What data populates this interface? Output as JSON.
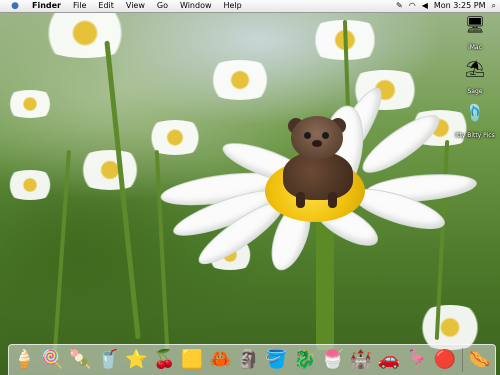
{
  "menubar": {
    "apple_label": "",
    "app_name": "Finder",
    "menus": [
      "File",
      "Edit",
      "View",
      "Go",
      "Window",
      "Help"
    ],
    "clock": "Mon 3:25 PM"
  },
  "desktop_icons": [
    {
      "label": "iMac",
      "icon": "hard-drive-icon"
    },
    {
      "label": "Sage",
      "icon": "beach-umbrella-icon"
    },
    {
      "label": "Itty Bitty Pics",
      "icon": "flip-flops-icon"
    }
  ],
  "dock": {
    "items": [
      {
        "icon": "ice-cream-cone-icon",
        "glyph": "🍦"
      },
      {
        "icon": "popsicle-icon",
        "glyph": "🍭"
      },
      {
        "icon": "blue-popsicle-icon",
        "glyph": "🍡"
      },
      {
        "icon": "lemonade-icon",
        "glyph": "🥤"
      },
      {
        "icon": "starfish-icon",
        "glyph": "⭐"
      },
      {
        "icon": "cherries-icon",
        "glyph": "🍒"
      },
      {
        "icon": "sponge-character-icon",
        "glyph": "🟨"
      },
      {
        "icon": "crab-character-icon",
        "glyph": "🦀"
      },
      {
        "icon": "tiki-figure-icon",
        "glyph": "🗿"
      },
      {
        "icon": "sand-bucket-icon",
        "glyph": "🪣"
      },
      {
        "icon": "seahorse-icon",
        "glyph": "🐉"
      },
      {
        "icon": "red-popsicle-icon",
        "glyph": "🍧"
      },
      {
        "icon": "sandcastle-icon",
        "glyph": "🏰"
      },
      {
        "icon": "toy-car-icon",
        "glyph": "🚗"
      },
      {
        "icon": "flamingo-icon",
        "glyph": "🦩"
      },
      {
        "icon": "beach-ball-icon",
        "glyph": "🔴"
      },
      {
        "icon": "hot-dog-icon",
        "glyph": "🌭"
      }
    ]
  },
  "colors": {
    "menubar": "#f0f0f0",
    "daisy_center": "#f1c20e",
    "grass": "#4d7a2a"
  }
}
